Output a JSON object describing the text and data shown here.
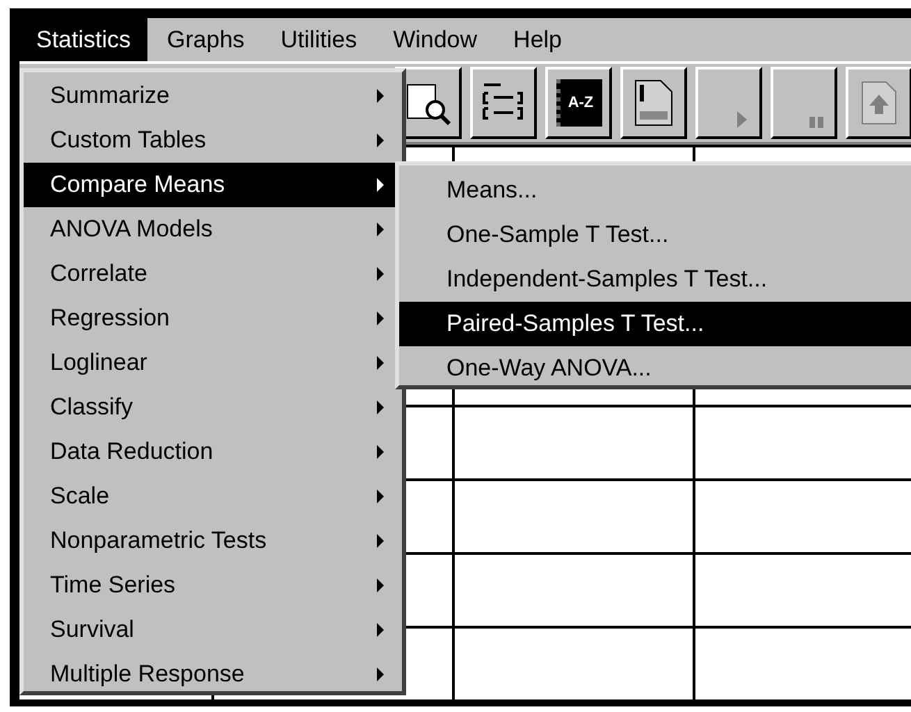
{
  "menubar": [
    {
      "label": "Statistics",
      "selected": true
    },
    {
      "label": "Graphs",
      "selected": false
    },
    {
      "label": "Utilities",
      "selected": false
    },
    {
      "label": "Window",
      "selected": false
    },
    {
      "label": "Help",
      "selected": false
    }
  ],
  "toolbar": [
    {
      "kind": "find"
    },
    {
      "kind": "list"
    },
    {
      "kind": "book",
      "label": "A-Z"
    },
    {
      "kind": "doc"
    },
    {
      "kind": "play"
    },
    {
      "kind": "pause"
    },
    {
      "kind": "upload"
    }
  ],
  "statistics_menu": [
    {
      "label": "Summarize",
      "selected": false
    },
    {
      "label": "Custom Tables",
      "selected": false
    },
    {
      "label": "Compare Means",
      "selected": true
    },
    {
      "label": "ANOVA Models",
      "selected": false
    },
    {
      "label": "Correlate",
      "selected": false
    },
    {
      "label": "Regression",
      "selected": false
    },
    {
      "label": "Loglinear",
      "selected": false
    },
    {
      "label": "Classify",
      "selected": false
    },
    {
      "label": "Data Reduction",
      "selected": false
    },
    {
      "label": "Scale",
      "selected": false
    },
    {
      "label": "Nonparametric Tests",
      "selected": false
    },
    {
      "label": "Time Series",
      "selected": false
    },
    {
      "label": "Survival",
      "selected": false
    },
    {
      "label": "Multiple Response",
      "selected": false
    }
  ],
  "compare_means_menu": [
    {
      "label": "Means...",
      "selected": false
    },
    {
      "label": "One-Sample T Test...",
      "selected": false
    },
    {
      "label": "Independent-Samples T Test...",
      "selected": false
    },
    {
      "label": "Paired-Samples T Test...",
      "selected": true
    },
    {
      "label": "One-Way ANOVA...",
      "selected": false
    }
  ]
}
